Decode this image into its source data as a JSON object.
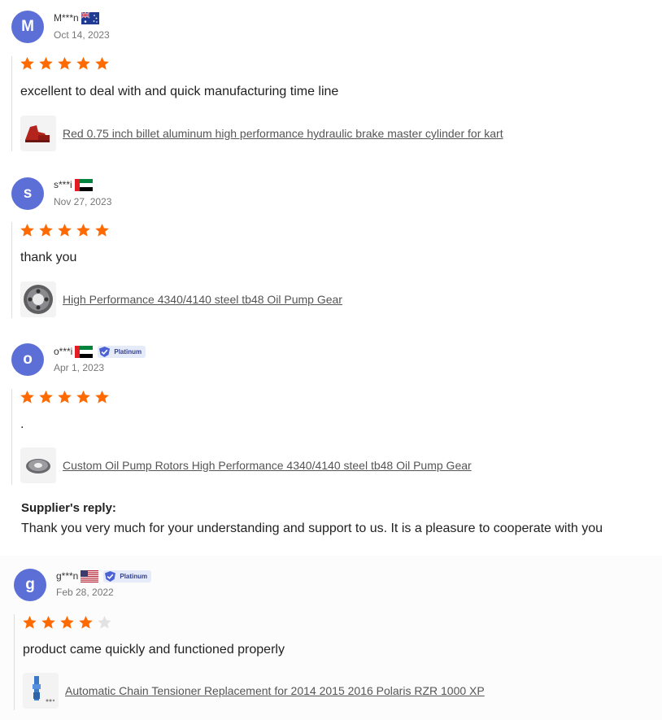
{
  "reviews": [
    {
      "avatar_letter": "M",
      "user": "M***n",
      "flag": "australia-flag",
      "date": "Oct 14, 2023",
      "rating": 5,
      "text": "excellent to deal with and quick manufacturing time line",
      "product": "Red 0.75 inch billet aluminum high performance hydraulic brake master cylinder for kart"
    },
    {
      "avatar_letter": "s",
      "user": "s***i",
      "flag": "uae-flag",
      "date": "Nov 27, 2023",
      "rating": 5,
      "text": "thank you",
      "product": "High Performance 4340/4140 steel tb48 Oil Pump Gear"
    },
    {
      "avatar_letter": "o",
      "user": "o***i",
      "flag": "uae-flag",
      "badge": "Platinum",
      "date": "Apr 1, 2023",
      "rating": 5,
      "text": ".",
      "product": "Custom Oil Pump Rotors High Performance 4340/4140 steel tb48 Oil Pump Gear",
      "reply_title": "Supplier's reply:",
      "reply_text": "Thank you very much for your understanding and support to us. It is a pleasure to cooperate with you"
    },
    {
      "avatar_letter": "g",
      "user": "g***n",
      "flag": "usa-flag",
      "badge": "Platinum",
      "date": "Feb 28, 2022",
      "rating": 4,
      "text": "product came quickly and functioned properly",
      "product": "Automatic Chain Tensioner Replacement for 2014 2015 2016 Polaris RZR 1000 XP"
    }
  ],
  "colors": {
    "avatar": "#5b6fd6",
    "star_filled": "#ff6a00",
    "star_empty": "#e2e2e2",
    "badge_bg": "#e6ebfa",
    "badge_text": "#33408f"
  }
}
